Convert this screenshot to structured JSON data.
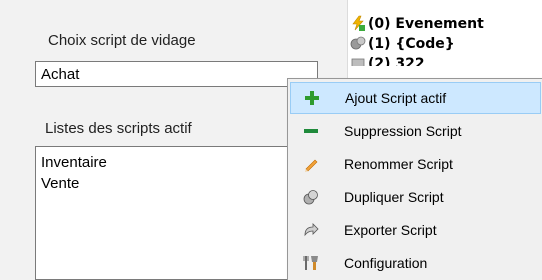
{
  "left_panel": {
    "choix_label": "Choix script de vidage",
    "choix_value": "Achat",
    "listes_label": "Listes des scripts actif",
    "scripts": [
      "Inventaire",
      "Vente"
    ]
  },
  "tree": {
    "items": [
      {
        "text": "(0) Evenement",
        "icon": "event-icon"
      },
      {
        "text": "(1) {Code}",
        "icon": "code-icon"
      },
      {
        "text": "(2) 322",
        "icon": "item-icon"
      }
    ]
  },
  "context_menu": {
    "items": [
      {
        "label": "Ajout Script actif",
        "icon": "plus-icon",
        "highlighted": true
      },
      {
        "label": "Suppression Script",
        "icon": "minus-icon"
      },
      {
        "label": "Renommer Script",
        "icon": "pencil-icon"
      },
      {
        "label": "Dupliquer Script",
        "icon": "duplicate-icon"
      },
      {
        "label": "Exporter Script",
        "icon": "export-icon"
      },
      {
        "label": "Configuration",
        "icon": "configuration-icon"
      }
    ]
  },
  "colors": {
    "highlight": "#cde8ff",
    "plus_green": "#2e9b2e",
    "minus_green": "#1f8a3b",
    "pencil_orange": "#e07b00"
  }
}
